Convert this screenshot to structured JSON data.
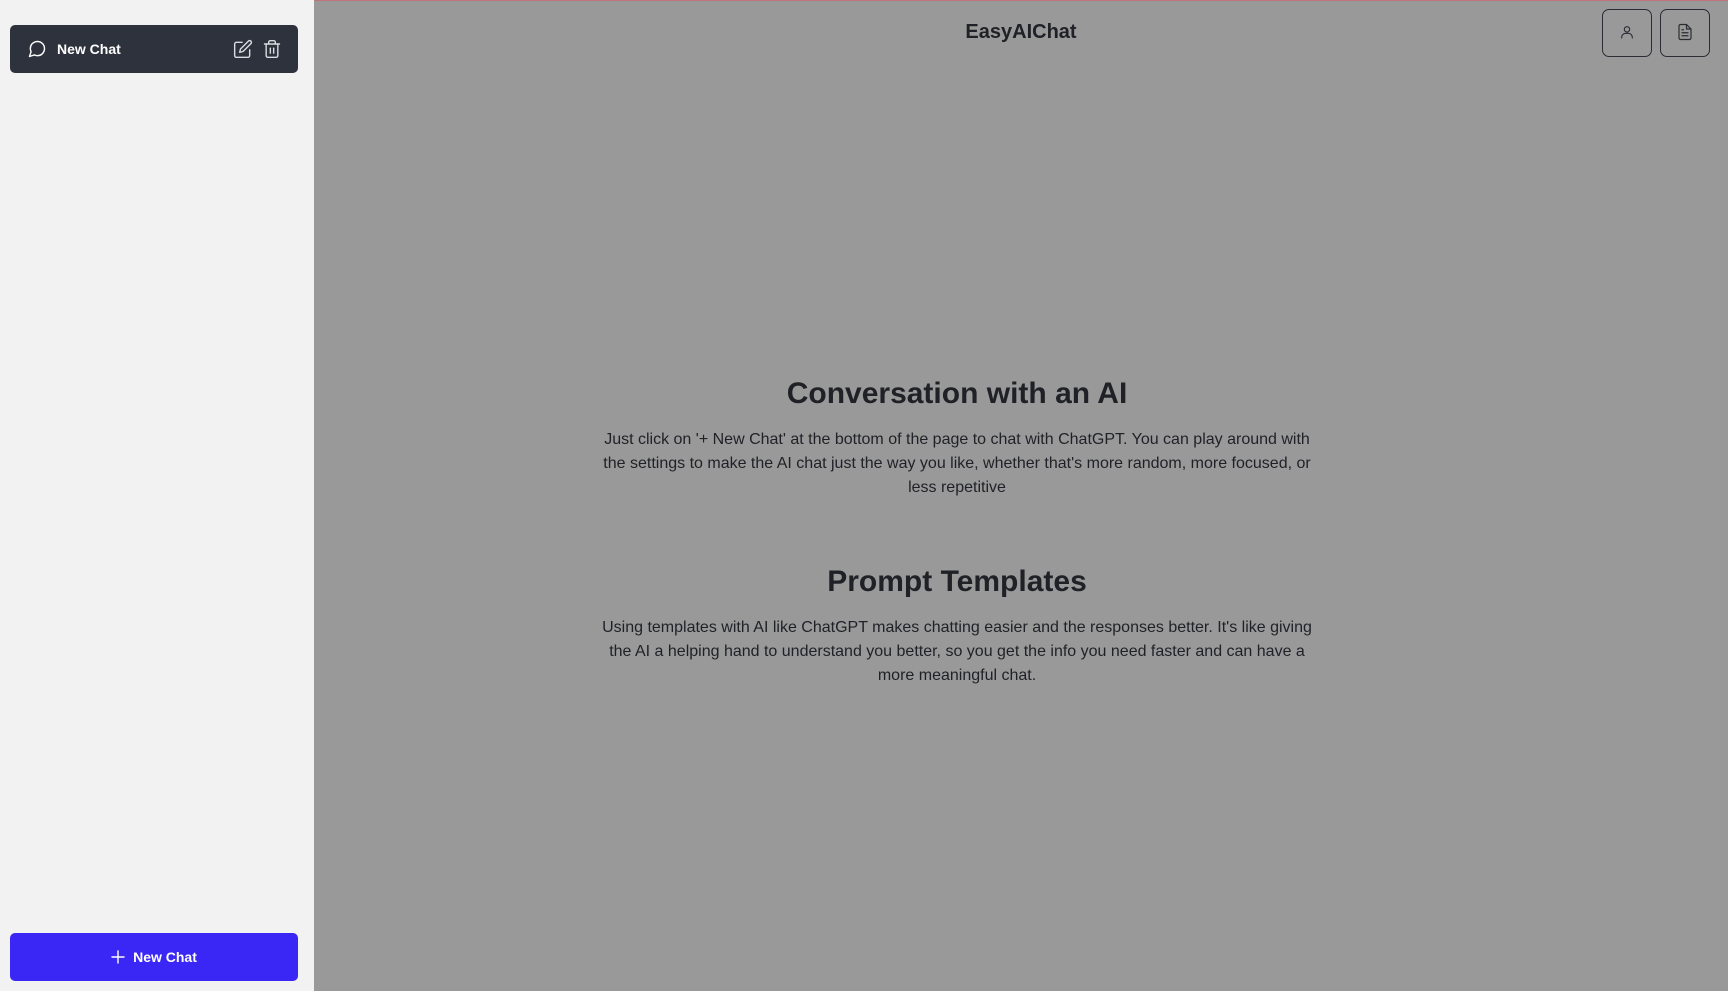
{
  "sidebar": {
    "chat_items": [
      {
        "label": "New Chat",
        "icon": "chat-bubble-icon",
        "actions": [
          "edit-icon",
          "trash-icon"
        ]
      }
    ],
    "new_chat_button": {
      "label": "New Chat",
      "icon": "plus-icon"
    }
  },
  "header": {
    "title": "EasyAIChat",
    "buttons": [
      {
        "icon": "user-icon"
      },
      {
        "icon": "document-icon"
      }
    ]
  },
  "main": {
    "sections": [
      {
        "heading": "Conversation with an AI",
        "body": "Just click on '+ New Chat' at the bottom of the page to chat with ChatGPT. You can play around with the settings to make the AI chat just the way you like, whether that's more random, more focused, or less repetitive"
      },
      {
        "heading": "Prompt Templates",
        "body": "Using templates with AI like ChatGPT makes chatting easier and the responses better. It's like giving the AI a helping hand to understand you better, so you get the info you need faster and can have a more meaningful chat."
      }
    ]
  },
  "colors": {
    "sidebar_bg": "#f2f2f2",
    "main_bg": "#999999",
    "chat_item_bg": "#2d323c",
    "accent": "#3a27f5",
    "text": "#1f2126"
  }
}
